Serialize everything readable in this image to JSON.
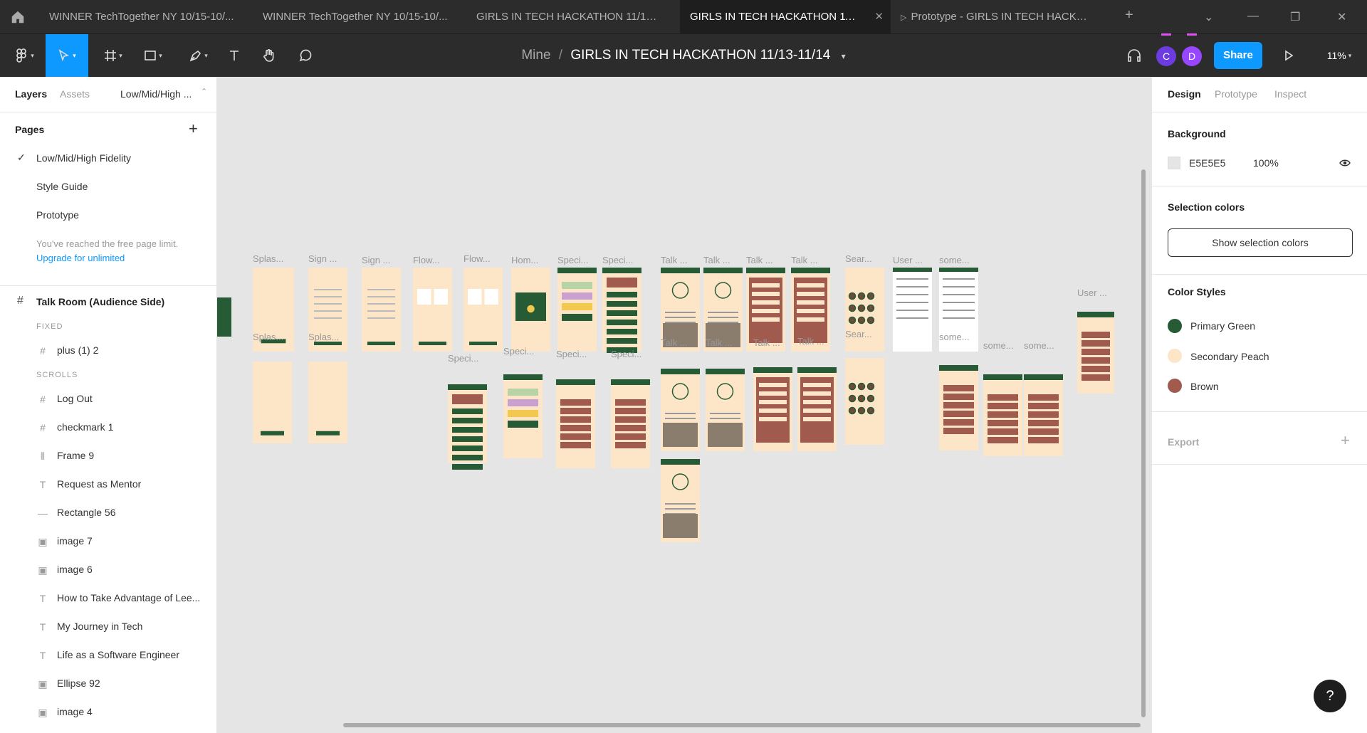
{
  "tabs": [
    {
      "label": "WINNER TechTogether NY 10/15-10/..."
    },
    {
      "label": "WINNER TechTogether NY 10/15-10/..."
    },
    {
      "label": "GIRLS IN TECH HACKATHON 11/13-..."
    },
    {
      "label": "GIRLS IN TECH HACKATHON 11/13-...",
      "active": true
    },
    {
      "label": "Prototype - GIRLS IN TECH HACKAT..."
    }
  ],
  "new_tab": "+",
  "breadcrumb": {
    "team": "Mine",
    "separator": "/",
    "file": "GIRLS IN TECH HACKATHON 11/13-11/14"
  },
  "avatars": [
    {
      "letter": "C",
      "color": "#6c3ce1"
    },
    {
      "letter": "D",
      "color": "#9747ff"
    }
  ],
  "share_label": "Share",
  "zoom": "11%",
  "left_panel": {
    "tabs": [
      "Layers",
      "Assets"
    ],
    "current_page_short": "Low/Mid/High ...",
    "pages_title": "Pages",
    "add_page": "+",
    "pages": [
      {
        "label": "Low/Mid/High Fidelity",
        "checked": true
      },
      {
        "label": "Style Guide"
      },
      {
        "label": "Prototype"
      }
    ],
    "limit_text": "You've reached the free page limit.",
    "upgrade_link": "Upgrade for unlimited",
    "frame_name": "Talk Room (Audience Side)",
    "fixed_label": "FIXED",
    "fixed_layers": [
      {
        "name": "plus (1) 2",
        "icon": "frame-icon"
      }
    ],
    "scrolls_label": "SCROLLS",
    "scroll_layers": [
      {
        "name": "Log Out",
        "icon": "frame-icon"
      },
      {
        "name": "checkmark 1",
        "icon": "frame-icon"
      },
      {
        "name": "Frame 9",
        "icon": "columns-icon"
      },
      {
        "name": "Request as Mentor",
        "icon": "text-icon"
      },
      {
        "name": "Rectangle 56",
        "icon": "line-icon"
      },
      {
        "name": "image 7",
        "icon": "image-icon"
      },
      {
        "name": "image 6",
        "icon": "image-icon"
      },
      {
        "name": "How to Take Advantage of Lee...",
        "icon": "text-icon"
      },
      {
        "name": "My Journey in Tech",
        "icon": "text-icon"
      },
      {
        "name": "Life as a Software Engineer",
        "icon": "text-icon"
      },
      {
        "name": "Ellipse 92",
        "icon": "image-icon"
      },
      {
        "name": "image 4",
        "icon": "image-icon"
      }
    ]
  },
  "right_panel": {
    "tabs": [
      "Design",
      "Prototype",
      "Inspect"
    ],
    "background_title": "Background",
    "background_hex": "E5E5E5",
    "background_opacity": "100%",
    "selection_colors_title": "Selection colors",
    "show_selection_button": "Show selection colors",
    "color_styles_title": "Color Styles",
    "color_styles": [
      {
        "name": "Primary Green",
        "color": "#275b35"
      },
      {
        "name": "Secondary Peach",
        "color": "#fde6c8"
      },
      {
        "name": "Brown",
        "color": "#a05a4e"
      }
    ],
    "export_title": "Export",
    "export_add": "+"
  },
  "canvas_labels": {
    "row1": [
      "Splas...",
      "Sign ...",
      "Sign ...",
      "Flow...",
      "Flow...",
      "Hom...",
      "Speci...",
      "Speci...",
      "Talk ...",
      "Talk ...",
      "Talk ...",
      "Talk ...",
      "Sear...",
      "User ...",
      "some...",
      "User ..."
    ],
    "row2": [
      "Splas...",
      "Splas...",
      "Speci...",
      "Speci...",
      "Speci...",
      "Speci...",
      "Talk ...",
      "Talk ...",
      "Talk ...",
      "Talk ...",
      "Sear...",
      "some...",
      "some...",
      "some..."
    ]
  },
  "help": "?"
}
